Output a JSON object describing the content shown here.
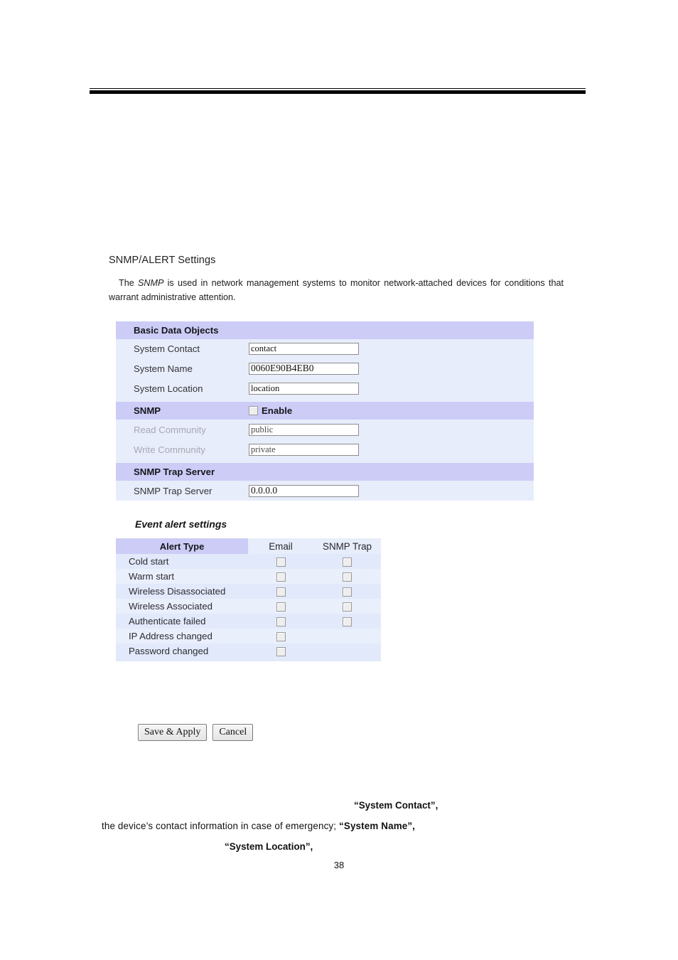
{
  "page": {
    "number": "38"
  },
  "ui": {
    "title": "SNMP/ALERT Settings",
    "description_lead": "The ",
    "description_italic": "SNMP",
    "description_rest": " is used in network management systems to monitor network-attached devices for conditions that warrant administrative attention."
  },
  "settings": {
    "sections": [
      {
        "title": "Basic Data Objects",
        "rows": [
          {
            "label": "System Contact",
            "value": "contact",
            "disabled": false
          },
          {
            "label": "System Name",
            "value": "0060E90B4EB0",
            "disabled": false
          },
          {
            "label": "System Location",
            "value": "location",
            "disabled": false
          }
        ]
      },
      {
        "title": "SNMP",
        "enable_label": "Enable",
        "enable_checked": false,
        "rows": [
          {
            "label": "Read Community",
            "value": "public",
            "disabled": true
          },
          {
            "label": "Write Community",
            "value": "private",
            "disabled": true
          }
        ]
      },
      {
        "title": "SNMP Trap Server",
        "rows": [
          {
            "label": "SNMP Trap Server",
            "value": "0.0.0.0",
            "disabled": false
          }
        ]
      }
    ]
  },
  "event_alerts": {
    "title": "Event alert settings",
    "columns": [
      "Alert Type",
      "Email",
      "SNMP Trap"
    ],
    "rows": [
      {
        "type": "Cold start",
        "email": false,
        "snmp_trap": false,
        "has_email": true,
        "has_snmp_trap": true
      },
      {
        "type": "Warm start",
        "email": false,
        "snmp_trap": false,
        "has_email": true,
        "has_snmp_trap": true
      },
      {
        "type": "Wireless Disassociated",
        "email": false,
        "snmp_trap": false,
        "has_email": true,
        "has_snmp_trap": true
      },
      {
        "type": "Wireless Associated",
        "email": false,
        "snmp_trap": false,
        "has_email": true,
        "has_snmp_trap": true
      },
      {
        "type": "Authenticate failed",
        "email": false,
        "snmp_trap": false,
        "has_email": true,
        "has_snmp_trap": true
      },
      {
        "type": "IP Address changed",
        "email": false,
        "snmp_trap": null,
        "has_email": true,
        "has_snmp_trap": false
      },
      {
        "type": "Password changed",
        "email": false,
        "snmp_trap": null,
        "has_email": true,
        "has_snmp_trap": false
      }
    ]
  },
  "buttons": {
    "save": "Save & Apply",
    "cancel": "Cancel"
  },
  "doc_text": {
    "line1_bold": "“System Contact”,",
    "line2_plain": "the device’s contact information in case of emergency; ",
    "line2_bold": "“System Name”,",
    "line3_bold": "“System Location”,"
  },
  "colors": {
    "section_header": "#ccccf7",
    "data_row": "#e8edfb",
    "alert_row": "#e2e9fa",
    "alert_row_alt": "#eaeffc",
    "disabled_label": "#a8a8b4"
  }
}
